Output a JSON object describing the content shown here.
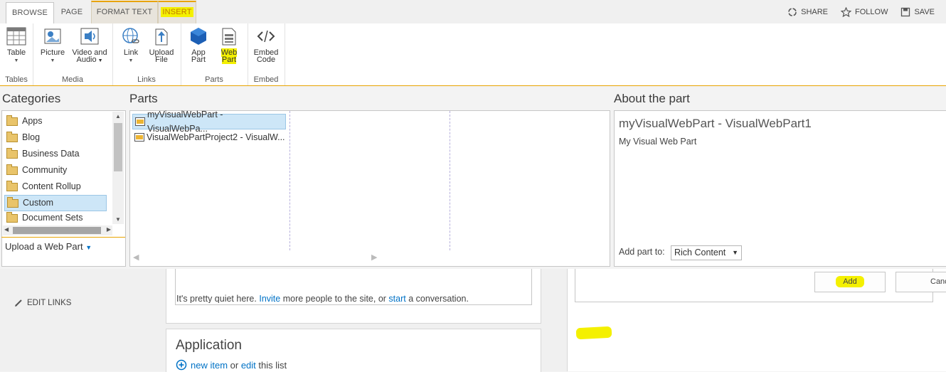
{
  "tabs": [
    {
      "label": "BROWSE"
    },
    {
      "label": "PAGE"
    },
    {
      "label": "FORMAT TEXT"
    },
    {
      "label": "INSERT"
    }
  ],
  "actions": {
    "share": "SHARE",
    "follow": "FOLLOW",
    "save": "SAVE"
  },
  "ribbon": {
    "groups": [
      {
        "name": "Tables",
        "buttons": [
          "Table"
        ]
      },
      {
        "name": "Media",
        "buttons": [
          "Picture",
          "Video and Audio"
        ]
      },
      {
        "name": "Links",
        "buttons": [
          "Link",
          "Upload File"
        ]
      },
      {
        "name": "Parts",
        "buttons": [
          "App Part",
          "Web Part"
        ]
      },
      {
        "name": "Embed",
        "buttons": [
          "Embed Code"
        ]
      }
    ],
    "labels": {
      "table": "Table",
      "picture": "Picture",
      "video1": "Video and",
      "video2": "Audio",
      "link": "Link",
      "upload1": "Upload",
      "upload2": "File",
      "app1": "App",
      "app2": "Part",
      "web1": "Web",
      "web2": "Part",
      "embed1": "Embed",
      "embed2": "Code"
    }
  },
  "picker": {
    "categories_title": "Categories",
    "parts_title": "Parts",
    "about_title": "About the part",
    "categories": [
      "Apps",
      "Blog",
      "Business Data",
      "Community",
      "Content Rollup",
      "Custom",
      "Document Sets"
    ],
    "selected_category": "Custom",
    "upload_label": "Upload a Web Part",
    "parts": [
      "myVisualWebPart - VisualWebPa...",
      "VisualWebPartProject2 - VisualW..."
    ],
    "selected_part": "myVisualWebPart - VisualWebPa...",
    "about": {
      "name": "myVisualWebPart - VisualWebPart1",
      "description": "My Visual Web Part",
      "add_part_to_label": "Add part to:",
      "add_part_to_value": "Rich Content"
    },
    "add_button": "Add",
    "cancel_button": "Cancel"
  },
  "page": {
    "edit_links": "EDIT LINKS",
    "quiet_text_a": "It's pretty quiet here. ",
    "quiet_link_invite": "Invite",
    "quiet_text_b": " more people to the site, or ",
    "quiet_link_start": "start",
    "quiet_text_c": " a conversation.",
    "app_title": "Application",
    "new_item": "new item",
    "or": " or ",
    "edit": "edit",
    "this_list": " this list"
  },
  "colors": {
    "accent": "#e8a300",
    "highlight": "#f4f000",
    "link": "#0072c6",
    "selection": "#cde6f7"
  }
}
